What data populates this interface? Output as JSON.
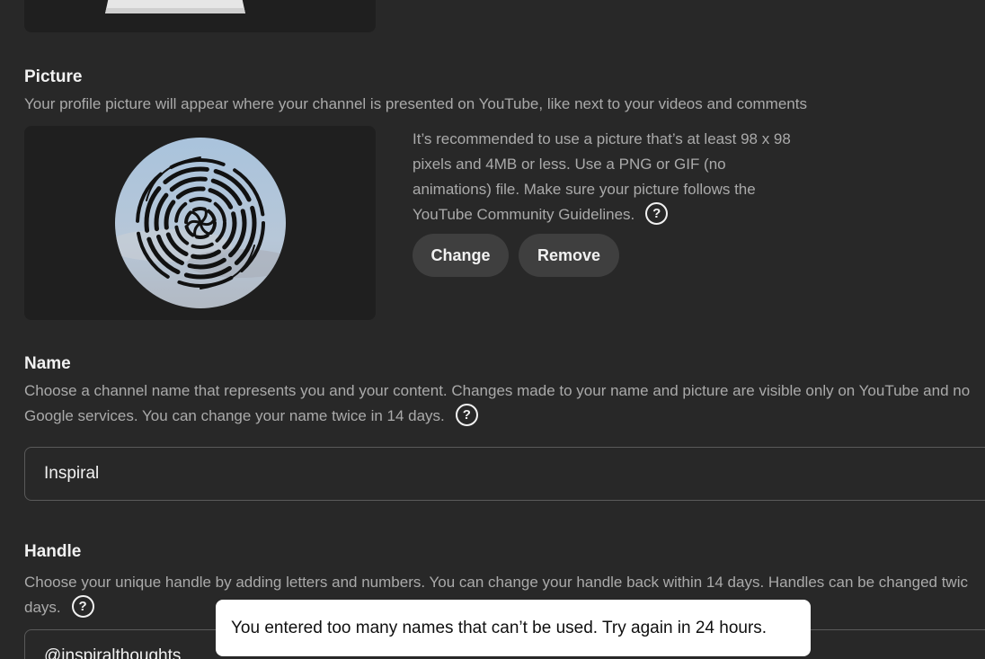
{
  "picture": {
    "title": "Picture",
    "description": "Your profile picture will appear where your channel is presented on YouTube, like next to your videos and comments",
    "info_line1": "It’s recommended to use a picture that’s at least 98 x 98",
    "info_line2": "pixels and 4MB or less. Use a PNG or GIF (no",
    "info_line3": "animations) file. Make sure your picture follows the",
    "info_line4": "YouTube Community Guidelines.",
    "change_label": "Change",
    "remove_label": "Remove"
  },
  "name": {
    "title": "Name",
    "description_line1": "Choose a channel name that represents you and your content. Changes made to your name and picture are visible only on YouTube and no",
    "description_line2": "Google services. You can change your name twice in 14 days.",
    "value": "Inspiral"
  },
  "handle": {
    "title": "Handle",
    "description_line1": "Choose your unique handle by adding letters and numbers. You can change your handle back within 14 days. Handles can be changed twic",
    "description_line2": "days.",
    "value": "@inspiralthoughts"
  },
  "toast": {
    "message": "You entered too many names that can’t be used. Try again in 24 hours."
  },
  "icons": {
    "help": "help-circle-icon",
    "avatar": "spiral-avatar-image"
  },
  "colors": {
    "background": "#282828",
    "card": "#1f1f1f",
    "button": "#3f3f3f",
    "toast": "#ffffff"
  }
}
